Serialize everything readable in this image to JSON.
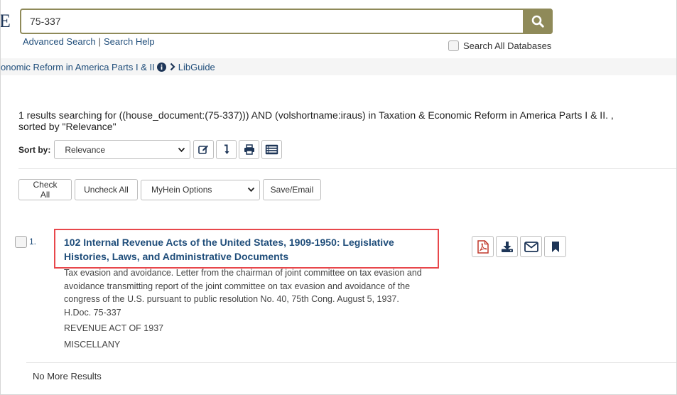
{
  "header": {
    "logo_letter": "E",
    "search": {
      "value": "75-337",
      "button_icon": "search-icon"
    },
    "links": {
      "advanced_search": "Advanced Search",
      "separator": "|",
      "search_help": "Search Help"
    },
    "search_all_databases": "Search All Databases"
  },
  "breadcrumb": {
    "collection": "onomic Reform in America Parts I & II",
    "libguide": "LibGuide"
  },
  "results": {
    "summary_line1": "1 results searching for ((house_document:(75-337))) AND (volshortname:iraus) in Taxation & Economic Reform in America Parts I & II. ,",
    "summary_line2": "sorted by \"Relevance\"",
    "sort_label": "Sort by:",
    "sort_value": "Relevance"
  },
  "actions": {
    "check_all": "Check All",
    "uncheck_all": "Uncheck All",
    "myhein_options": "MyHein Options",
    "save_email": "Save/Email"
  },
  "result_items": [
    {
      "number": "1.",
      "title": "102 Internal Revenue Acts of the United States, 1909-1950: Legislative Histories, Laws, and Administrative Documents",
      "description": "Tax evasion and avoidance. Letter from the chairman of joint committee on tax evasion and avoidance transmitting report of the joint committee on tax evasion and avoidance of the congress of the U.S. pursuant to public resolution No. 40, 75th Cong. August 5, 1937. H.Doc. 75-337",
      "meta1": "REVENUE ACT OF 1937",
      "meta2": "MISCELLANY"
    }
  ],
  "footer": {
    "no_more": "No More Results"
  },
  "colors": {
    "accent_olive": "#8f8a59",
    "link_blue": "#1f4d7a",
    "highlight_red": "#e8474b",
    "pdf_red": "#c0392b",
    "icon_navy": "#1d3557"
  }
}
